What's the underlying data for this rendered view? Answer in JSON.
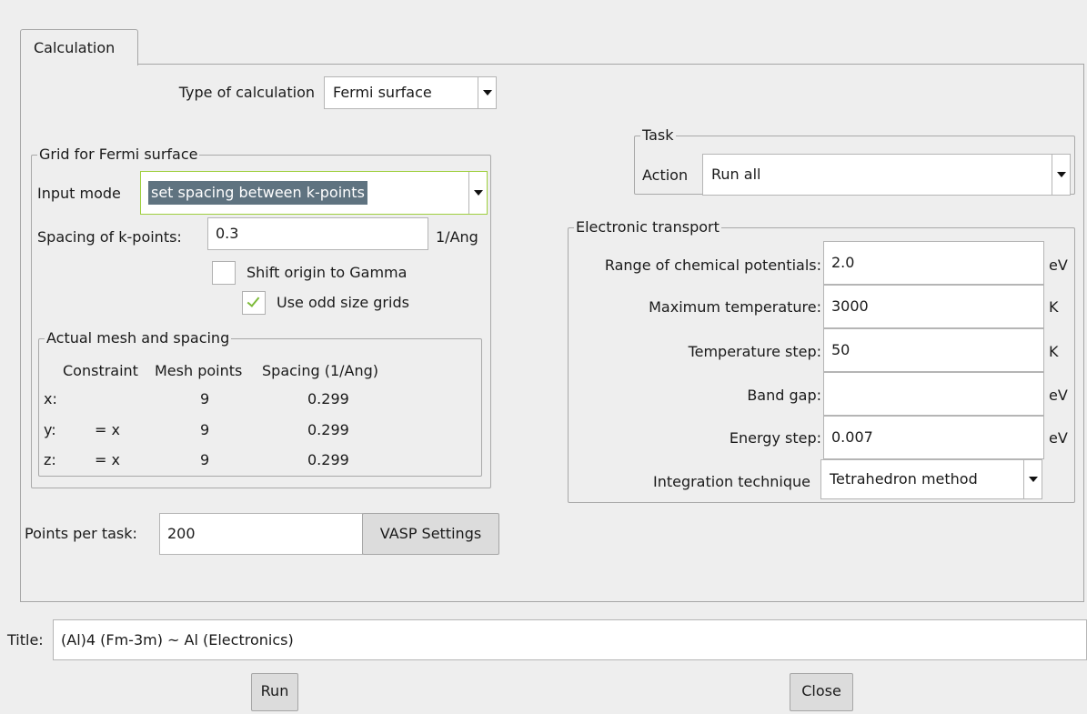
{
  "tabs": [
    "Calculation"
  ],
  "type_of_calculation": {
    "label": "Type of calculation",
    "value": "Fermi surface"
  },
  "grid": {
    "legend": "Grid for Fermi surface",
    "input_mode_label": "Input mode",
    "input_mode_value": "set spacing between k-points",
    "spacing_label": "Spacing of k-points:",
    "spacing_value": "0.3",
    "spacing_unit": "1/Ang",
    "shift_origin_label": "Shift origin to Gamma",
    "shift_origin_checked": false,
    "odd_grids_label": "Use odd size grids",
    "odd_grids_checked": true
  },
  "mesh": {
    "legend": "Actual mesh and spacing",
    "headers": [
      "Constraint",
      "Mesh points",
      "Spacing (1/Ang)"
    ],
    "rows": [
      {
        "axis": "x:",
        "constraint": "",
        "points": "9",
        "spacing": "0.299"
      },
      {
        "axis": "y:",
        "constraint": "= x",
        "points": "9",
        "spacing": "0.299"
      },
      {
        "axis": "z:",
        "constraint": "= x",
        "points": "9",
        "spacing": "0.299"
      }
    ]
  },
  "points_per_task": {
    "label": "Points per task:",
    "value": "200"
  },
  "vasp_settings_label": "VASP Settings",
  "task": {
    "legend": "Task",
    "action_label": "Action",
    "action_value": "Run all"
  },
  "transport": {
    "legend": "Electronic transport",
    "chem_pot_label": "Range of chemical potentials:",
    "chem_pot_value": "2.0",
    "chem_pot_unit": "eV",
    "max_temp_label": "Maximum temperature:",
    "max_temp_value": "3000",
    "max_temp_unit": "K",
    "temp_step_label": "Temperature step:",
    "temp_step_value": "50",
    "temp_step_unit": "K",
    "band_gap_label": "Band gap:",
    "band_gap_value": "",
    "band_gap_unit": "eV",
    "energy_step_label": "Energy step:",
    "energy_step_value": "0.007",
    "energy_step_unit": "eV",
    "integration_label": "Integration technique",
    "integration_value": "Tetrahedron method"
  },
  "title": {
    "label": "Title:",
    "value": "(Al)4  (Fm-3m) ~ Al (Electronics)"
  },
  "run_label": "Run",
  "close_label": "Close",
  "colors": {
    "highlight": "#5f7380",
    "focus_border": "#9fcf3f",
    "check": "#7dbb39"
  }
}
